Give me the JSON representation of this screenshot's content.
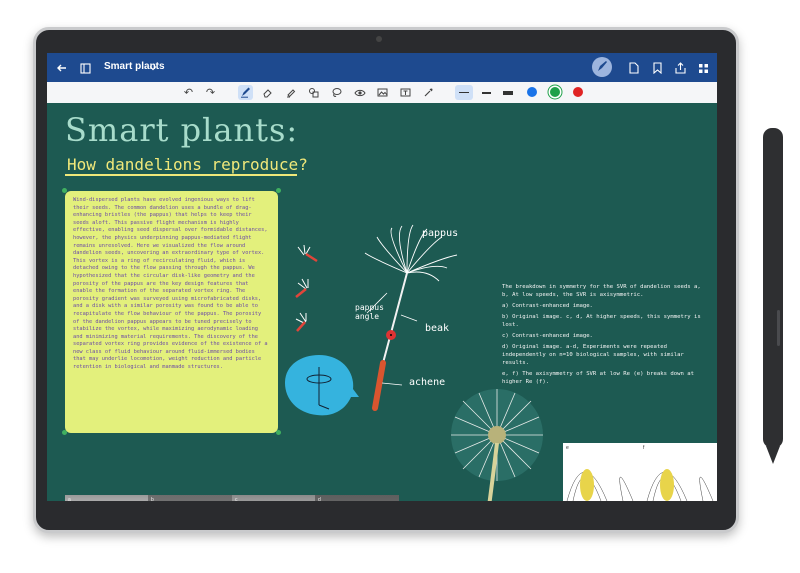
{
  "app": {
    "title": "Smart plants"
  },
  "canvas": {
    "heading": "Smart plants:",
    "subheading": "How dandelions reproduce?",
    "note_text": "Wind-dispersed plants have evolved ingenious ways to lift their seeds. The common dandelion uses a bundle of drag-enhancing bristles (the pappus) that helps to keep their seeds aloft. This passive flight mechanism is highly effective, enabling seed dispersal over formidable distances, however, the physics underpinning pappus-mediated flight remains unresolved. Here we visualized the flow around dandelion seeds, uncovering an extraordinary type of vortex. This vortex is a ring of recirculating fluid, which is detached owing to the flow passing through the pappus. We hypothesized that the circular disk-like geometry and the porosity of the pappus are the key design features that enable the formation of the separated vortex ring. The porosity gradient was surveyed using microfabricated disks, and a disk with a similar porosity was found to be able to recapitulate the flow behaviour of the pappus. The porosity of the dandelion pappus appears to be tuned precisely to stabilize the vortex, while maximizing aerodynamic loading and minimizing material requirements. The discovery of the separated vortex ring provides evidence of the existence of a new class of fluid behaviour around fluid-immersed bodies that may underlie locomotion, weight reduction and particle retention in biological and manmade structures.",
    "right_intro": "The breakdown in symmetry for the SVR of dandelion seeds a, b, At low speeds, the SVR is axisymmetric.",
    "right_items": [
      "a) Contrast-enhanced image.",
      "b) Original image. c, d, At higher speeds, this symmetry is lost.",
      "c) Contrast-enhanced image.",
      "d) Original image. a-d, Experiments were repeated independently on n=10 biological samples, with similar results.",
      "e, f) The axisymmetry of SVR at low Re (e) breaks down at higher Re (f)."
    ],
    "labels": {
      "pappus": "pappus",
      "pappus_angle": "pappus angle",
      "beak": "beak",
      "achene": "achene"
    },
    "panel_labels": [
      "a",
      "b",
      "c",
      "d",
      "e",
      "f"
    ]
  },
  "colors": {
    "titlebar": "#1e4a8f",
    "canvas_bg": "#1d5a52",
    "note_bg": "#e3f07c",
    "swatch_blue": "#1a73e8",
    "swatch_green": "#1fa14a",
    "swatch_red": "#e02424"
  },
  "icons": {
    "titlebar": [
      "back-arrow-icon",
      "sidebar-icon",
      "chevron-down-icon",
      "pen-icon",
      "file-icon",
      "bookmark-icon",
      "share-icon",
      "more-icon"
    ],
    "toolbar": [
      "undo-icon",
      "redo-icon",
      "pen-tool-icon",
      "eraser-icon",
      "highlighter-icon",
      "shapes-icon",
      "lasso-icon",
      "visibility-icon",
      "image-icon",
      "textbox-icon",
      "laser-icon"
    ]
  }
}
